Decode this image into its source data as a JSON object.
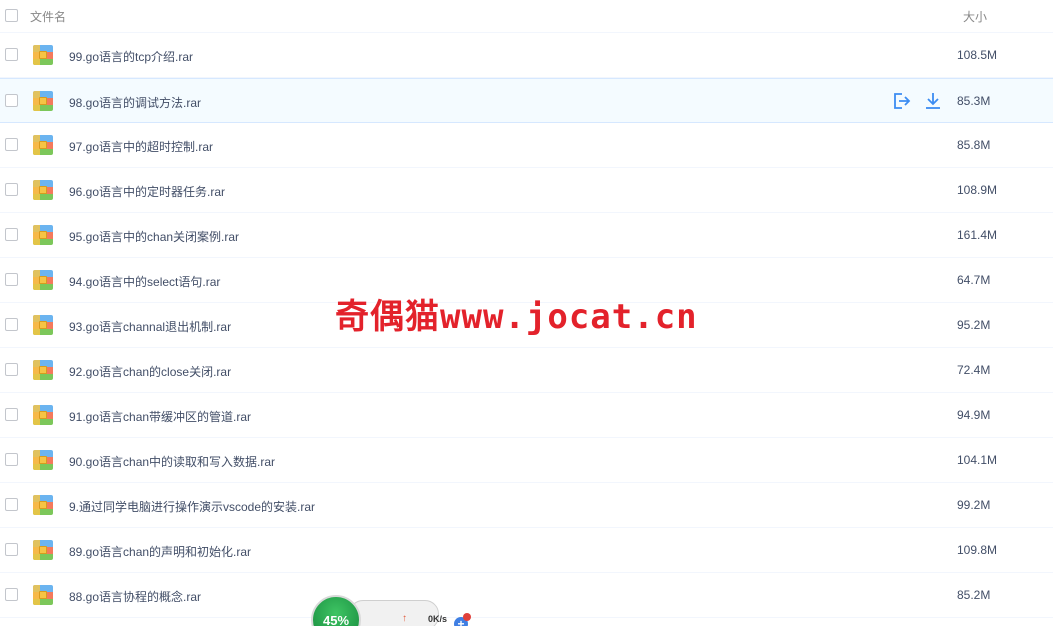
{
  "header": {
    "name_label": "文件名",
    "size_label": "大小"
  },
  "files": [
    {
      "name": "99.go语言的tcp介绍.rar",
      "size": "108.5M"
    },
    {
      "name": "98.go语言的调试方法.rar",
      "size": "85.3M"
    },
    {
      "name": "97.go语言中的超时控制.rar",
      "size": "85.8M"
    },
    {
      "name": "96.go语言中的定时器任务.rar",
      "size": "108.9M"
    },
    {
      "name": "95.go语言中的chan关闭案例.rar",
      "size": "161.4M"
    },
    {
      "name": "94.go语言中的select语句.rar",
      "size": "64.7M"
    },
    {
      "name": "93.go语言channal退出机制.rar",
      "size": "95.2M"
    },
    {
      "name": "92.go语言chan的close关闭.rar",
      "size": "72.4M"
    },
    {
      "name": "91.go语言chan带缓冲区的管道.rar",
      "size": "94.9M"
    },
    {
      "name": "90.go语言chan中的读取和写入数据.rar",
      "size": "104.1M"
    },
    {
      "name": "9.通过同学电脑进行操作演示vscode的安装.rar",
      "size": "99.2M"
    },
    {
      "name": "89.go语言chan的声明和初始化.rar",
      "size": "109.8M"
    },
    {
      "name": "88.go语言协程的概念.rar",
      "size": "85.2M"
    }
  ],
  "hover_row_index": 1,
  "row_actions": {
    "share_icon": "share-out-icon",
    "download_icon": "download-icon"
  },
  "watermark": {
    "text": "奇偶猫www.jocat.cn",
    "color": "#e3222b"
  },
  "speed_widget": {
    "percent": "45%",
    "upload_speed": "0K/s"
  },
  "colors": {
    "accent": "#3b8cf2",
    "hover_bg": "#f4fbff"
  }
}
